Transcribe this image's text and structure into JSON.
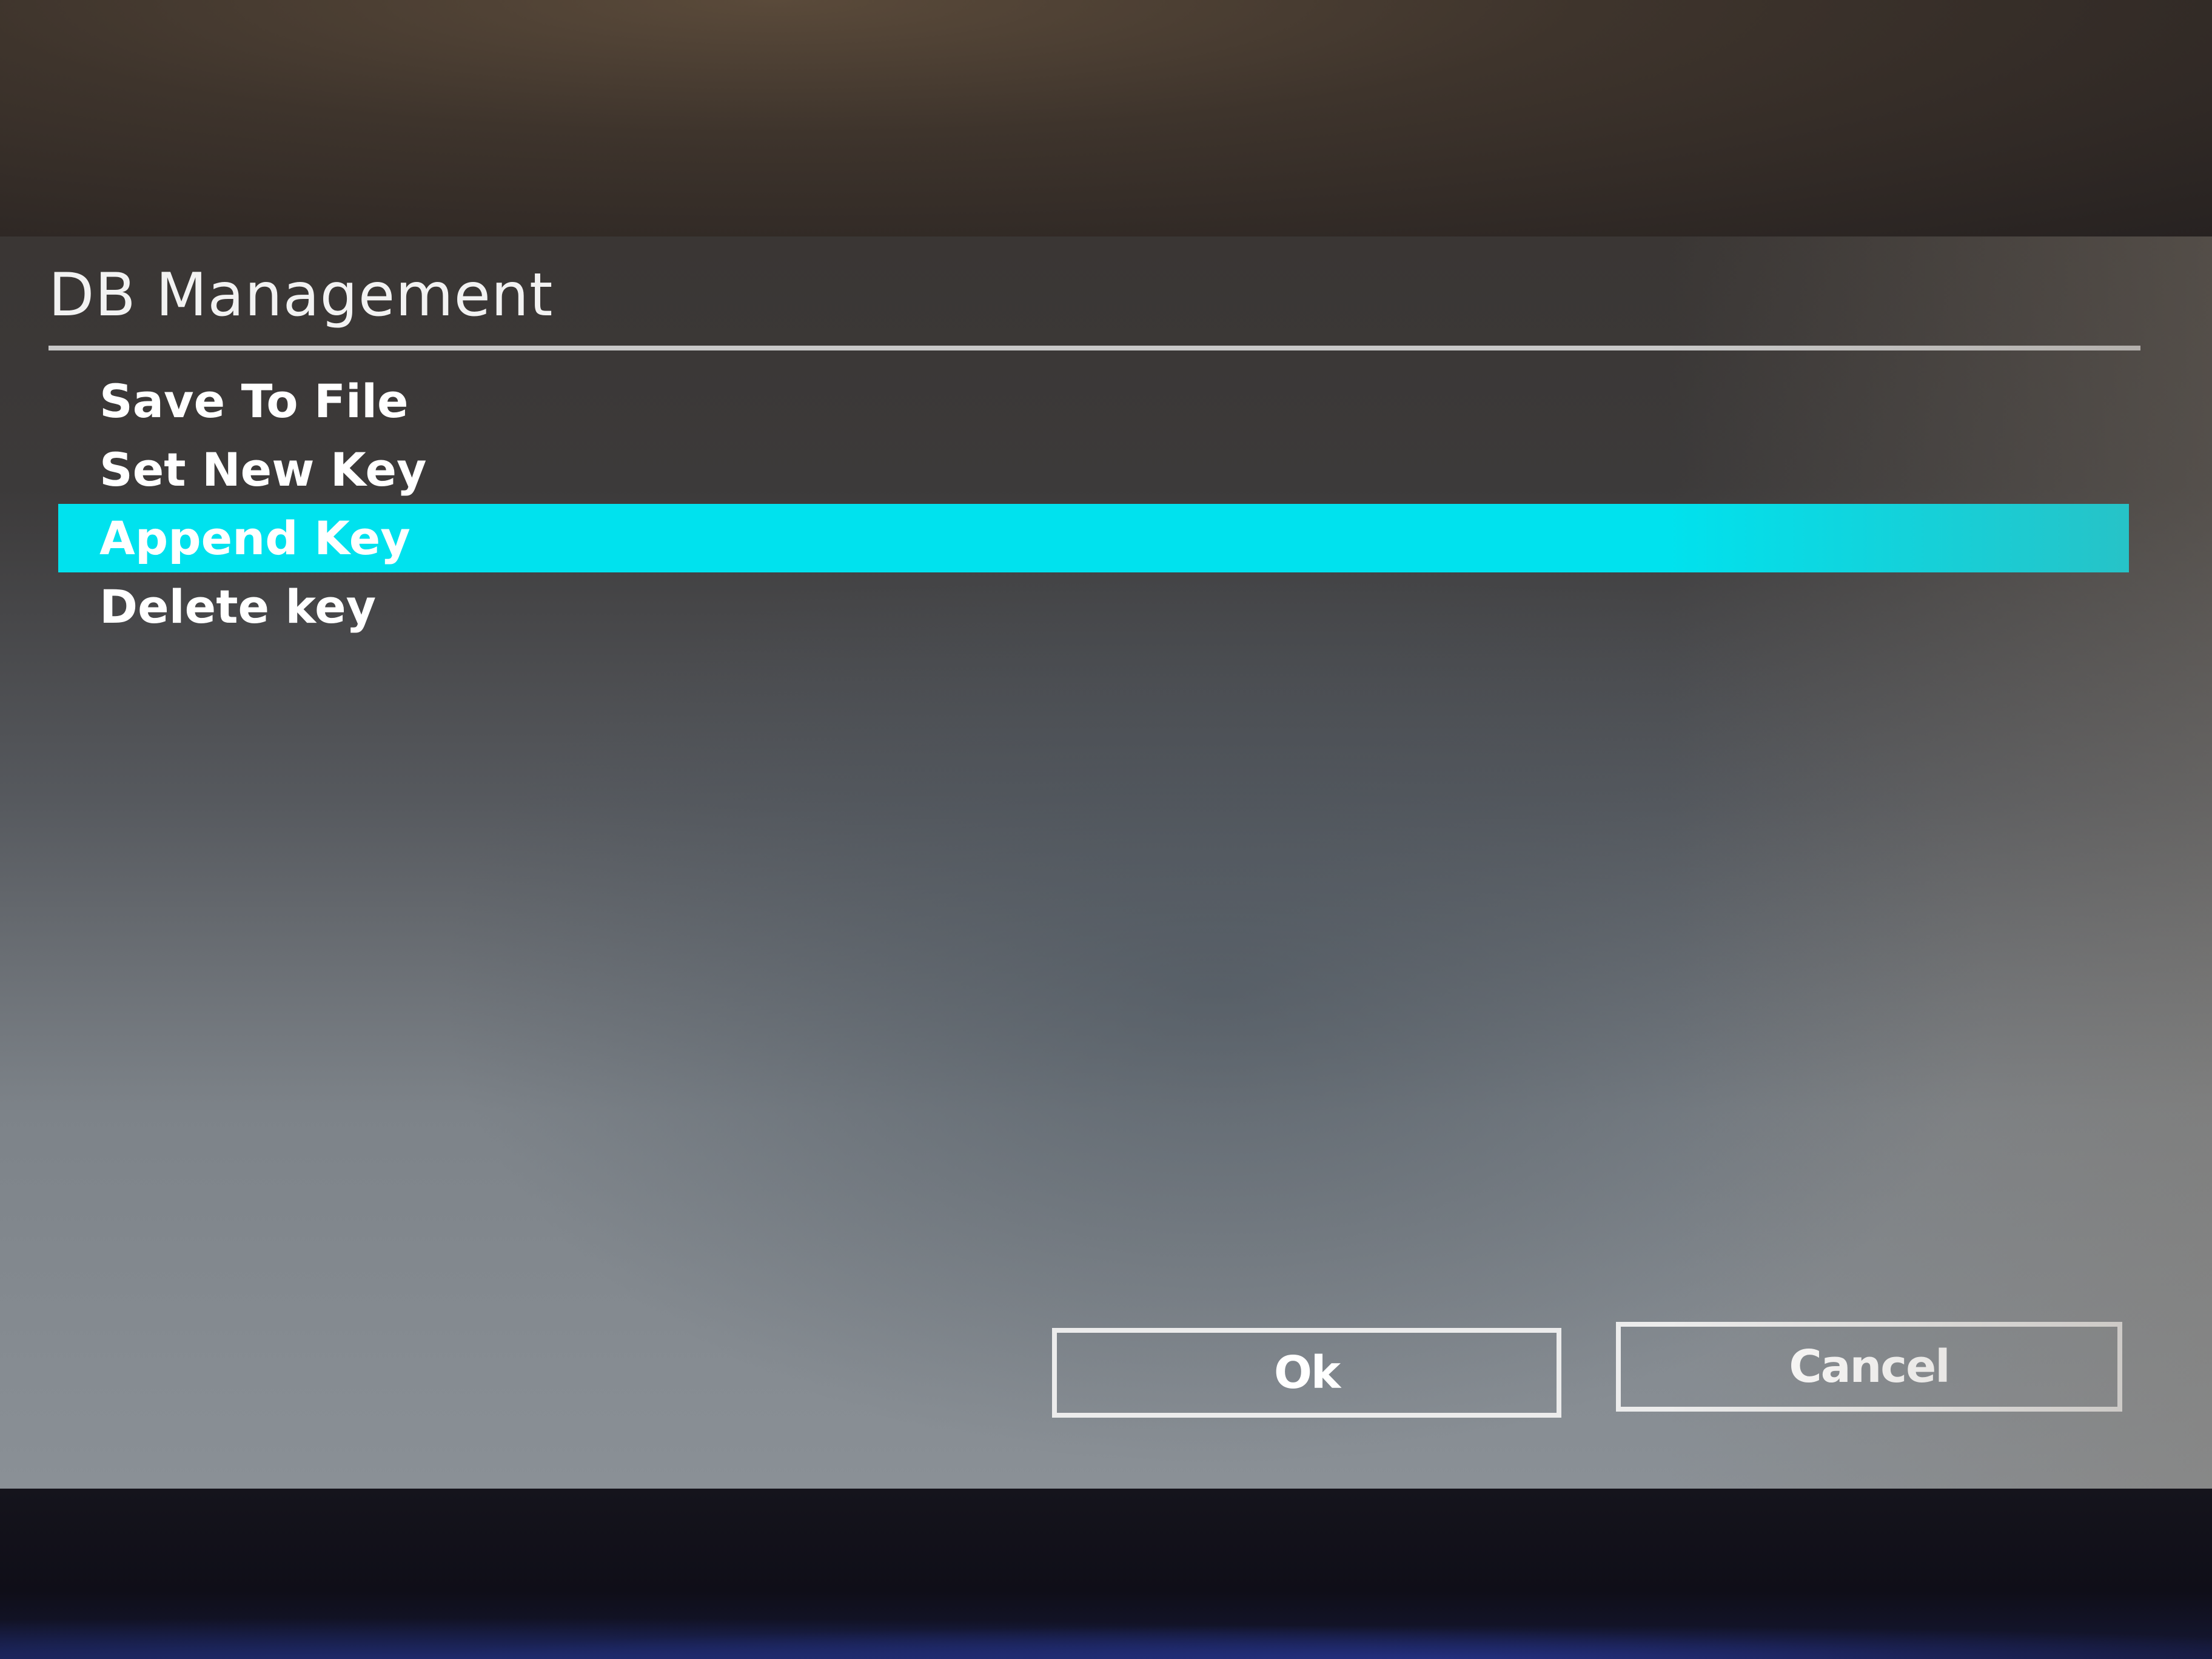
{
  "dialog": {
    "title": "DB Management",
    "menu_items": [
      {
        "label": "Save To File",
        "selected": false
      },
      {
        "label": "Set New Key",
        "selected": false
      },
      {
        "label": "Append Key",
        "selected": true
      },
      {
        "label": "Delete key",
        "selected": false
      }
    ],
    "ok_label": "Ok",
    "cancel_label": "Cancel"
  },
  "colors": {
    "selection_highlight": "#00e2ee",
    "text": "#ffffff",
    "button_border": "#ececec"
  }
}
